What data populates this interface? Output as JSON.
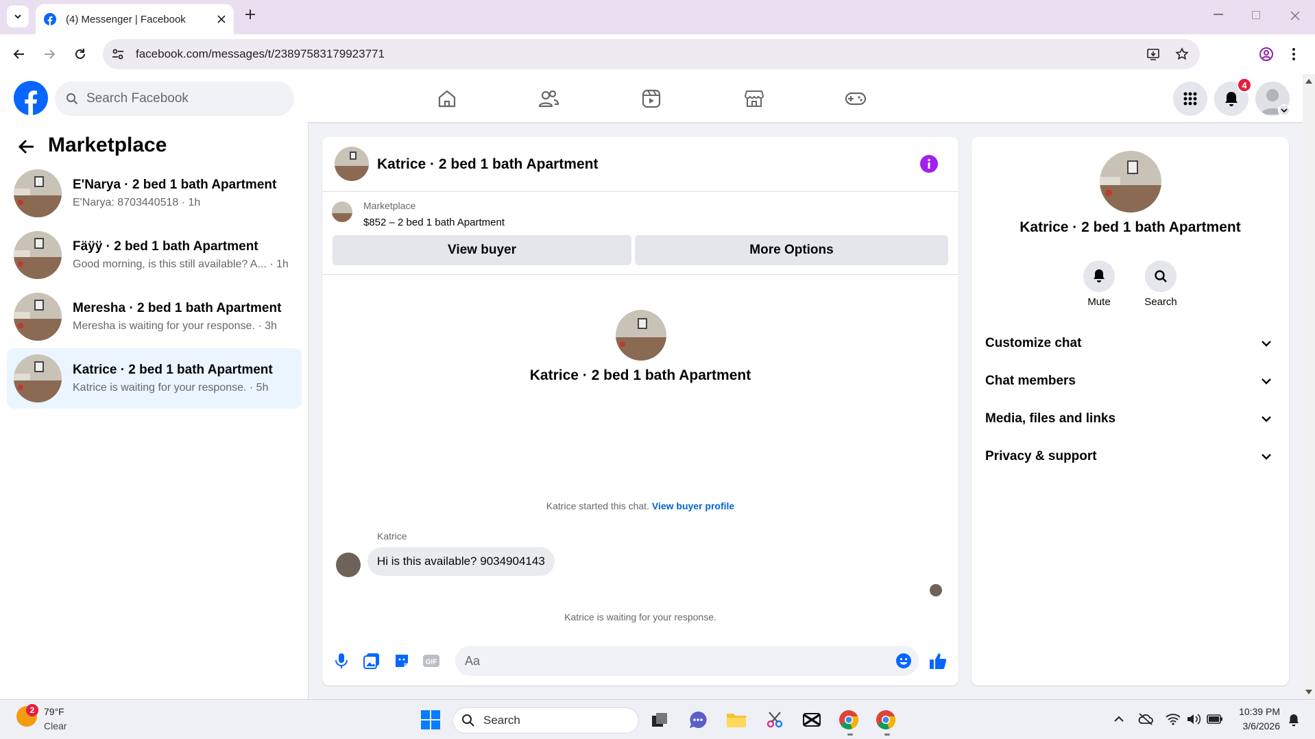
{
  "browser": {
    "tab_title": "(4) Messenger | Facebook",
    "url": "facebook.com/messages/t/23897583179923771"
  },
  "fb": {
    "search_placeholder": "Search Facebook",
    "notification_count": "4",
    "brand_color": "#0866ff"
  },
  "sidebar": {
    "title": "Marketplace",
    "conversations": [
      {
        "title": "E'Narya · 2 bed 1 bath Apartment",
        "preview": "E'Narya: 8703440518 · 1h"
      },
      {
        "title": "Fäÿÿ · 2 bed 1 bath Apartment",
        "preview": "Good morning, is this still available? A... · 1h"
      },
      {
        "title": "Meresha · 2 bed 1 bath Apartment",
        "preview": "Meresha is waiting for your response. · 3h"
      },
      {
        "title": "Katrice · 2 bed 1 bath Apartment",
        "preview": "Katrice is waiting for your response. · 5h"
      }
    ]
  },
  "chat": {
    "title": "Katrice · 2 bed 1 bath Apartment",
    "listing_source": "Marketplace",
    "listing": "$852 – 2 bed 1 bath Apartment",
    "view_buyer": "View buyer",
    "more_options": "More Options",
    "intro_name": "Katrice · 2 bed 1 bath Apartment",
    "started_text": "Katrice started this chat.",
    "view_buyer_profile": "View buyer profile",
    "sender": "Katrice",
    "message": "Hi is this available? 9034904143",
    "waiting": "Katrice is waiting for your response.",
    "composer_placeholder": "Aa"
  },
  "info": {
    "title": "Katrice · 2 bed 1 bath Apartment",
    "mute": "Mute",
    "search": "Search",
    "sections": [
      "Customize chat",
      "Chat members",
      "Media, files and links",
      "Privacy & support"
    ]
  },
  "taskbar": {
    "weather_badge": "2",
    "temp": "79°F",
    "condition": "Clear",
    "search": "Search",
    "time": "10:39 PM",
    "date": "3/6/2026"
  }
}
